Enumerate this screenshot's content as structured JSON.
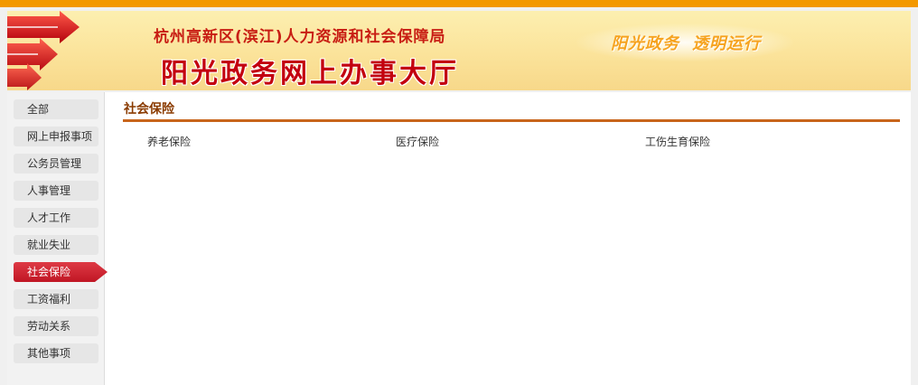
{
  "header": {
    "org_name": "杭州高新区(滨江)人力资源和社会保障局",
    "hall_title": "阳光政务网上办事大厅",
    "slogan_left": "阳光政务",
    "slogan_right": "透明运行"
  },
  "sidebar": {
    "items": [
      {
        "label": "全部"
      },
      {
        "label": "网上申报事项"
      },
      {
        "label": "公务员管理"
      },
      {
        "label": "人事管理"
      },
      {
        "label": "人才工作"
      },
      {
        "label": "就业失业"
      },
      {
        "label": "社会保险",
        "active": true
      },
      {
        "label": "工资福利"
      },
      {
        "label": "劳动关系"
      },
      {
        "label": "其他事项"
      }
    ]
  },
  "main": {
    "section_title": "社会保险",
    "links": [
      "养老保险",
      "医疗保险",
      "工伤生育保险"
    ]
  },
  "colors": {
    "top_bar": "#f39800",
    "accent_red": "#c8202d",
    "section_rule": "#c8651b",
    "section_title": "#8a3b00"
  }
}
